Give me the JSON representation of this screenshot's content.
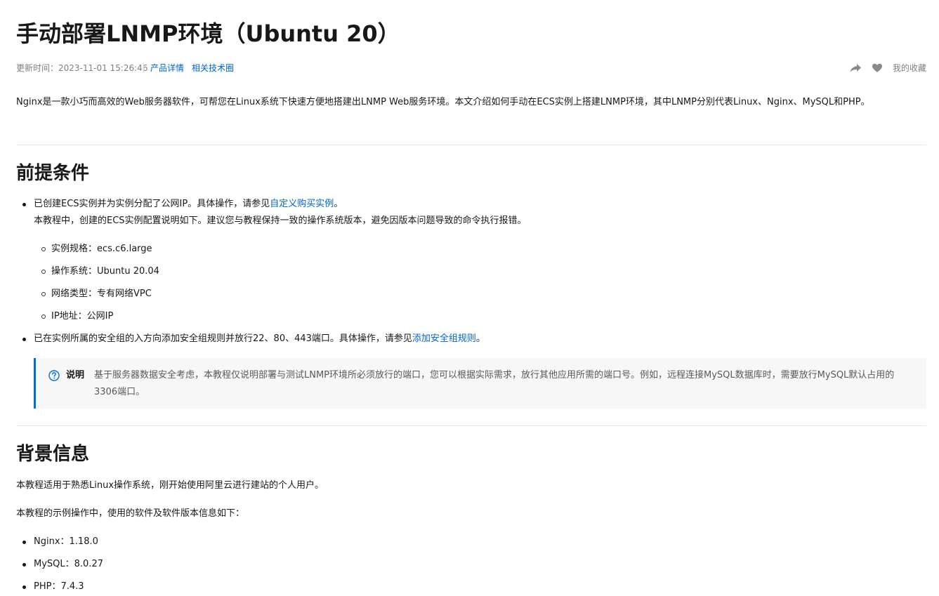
{
  "title": "手动部署LNMP环境（Ubuntu 20）",
  "meta": {
    "updated": "更新时间：2023-11-01 15:26:46",
    "link_product": "产品详情",
    "link_community": "相关技术圈",
    "favorite": "我的收藏",
    "icons": {
      "share": "share-icon",
      "heart": "heart-icon"
    }
  },
  "intro": "Nginx是一款小巧而高效的Web服务器软件，可帮您在Linux系统下快速方便地搭建出LNMP Web服务环境。本文介绍如何手动在ECS实例上搭建LNMP环境，其中LNMP分别代表Linux、Nginx、MySQL和PHP。",
  "prereq": {
    "heading": "前提条件",
    "item1": {
      "text": "已创建ECS实例并为实例分配了公网IP。具体操作，请参见",
      "link": "自定义购买实例",
      "end": "。",
      "detail": "本教程中，创建的ECS实例配置说明如下。建议您与教程保持一致的操作系统版本，避免因版本问题导致的命令执行报错。"
    },
    "specs": [
      "实例规格：ecs.c6.large",
      "操作系统：Ubuntu 20.04",
      "网络类型：专有网络VPC",
      "IP地址：公网IP"
    ],
    "item2": {
      "text": "已在实例所属的安全组的入方向添加安全组规则并放行22、80、443端口。具体操作，请参见",
      "link": "添加安全组规则",
      "end": "。"
    },
    "note": {
      "label": "说明",
      "text": "基于服务器数据安全考虑，本教程仅说明部署与测试LNMP环境所必须放行的端口，您可以根据实际需求，放行其他应用所需的端口号。例如，远程连接MySQL数据库时，需要放行MySQL默认占用的3306端口。",
      "accent": "#0070cc"
    }
  },
  "background": {
    "heading": "背景信息",
    "p1": "本教程适用于熟悉Linux操作系统，刚开始使用阿里云进行建站的个人用户。",
    "p2": "本教程的示例操作中，使用的软件及软件版本信息如下：",
    "software": [
      "Nginx：1.18.0",
      "MySQL：8.0.27",
      "PHP：7.4.3"
    ]
  },
  "colors": {
    "link": "#0064c8",
    "text": "#181818",
    "muted": "#808080"
  }
}
